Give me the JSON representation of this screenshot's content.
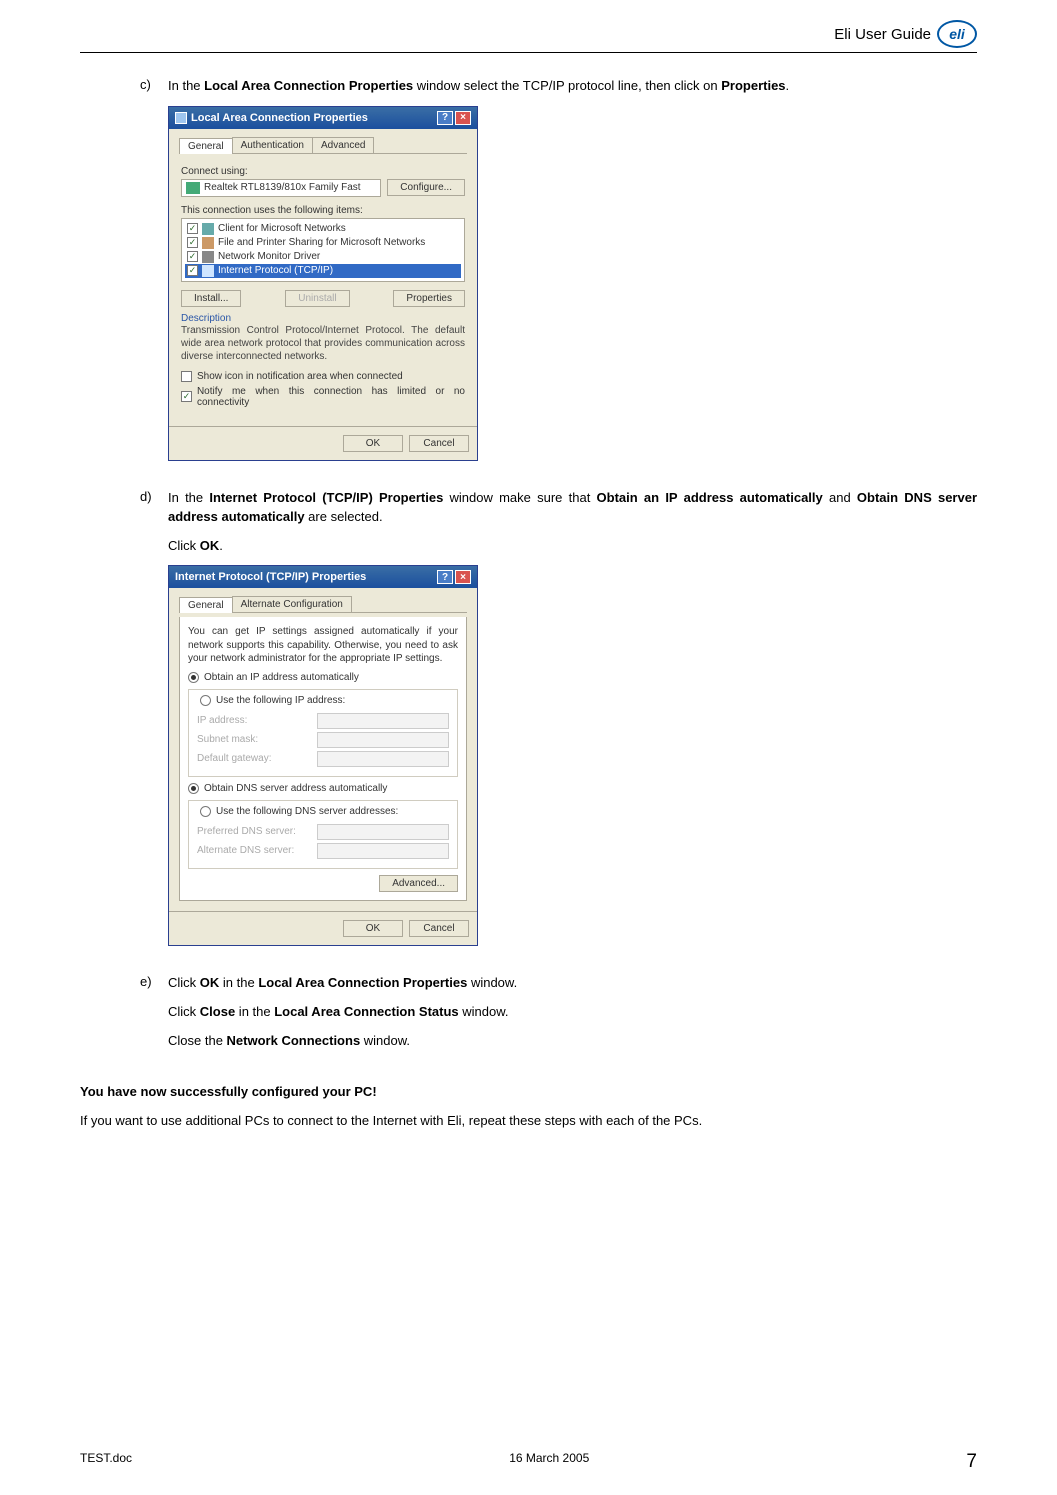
{
  "header": {
    "title": "Eli User Guide",
    "logo_text": "eli"
  },
  "steps": {
    "c": {
      "marker": "c)",
      "text_pre": "In the ",
      "bold1": "Local Area Connection Properties",
      "text_mid": " window select the TCP/IP protocol line, then click on ",
      "bold2": "Properties",
      "text_post": "."
    },
    "d": {
      "marker": "d)",
      "text_pre": "In the ",
      "bold1": "Internet Protocol (TCP/IP) Properties",
      "text_mid1": " window make sure that ",
      "bold2": "Obtain an IP address automatically",
      "text_mid2": " and ",
      "bold3": "Obtain DNS server address automatically",
      "text_post": " are selected.",
      "line2_pre": "Click ",
      "line2_bold": "OK",
      "line2_post": "."
    },
    "e": {
      "marker": "e)",
      "l1_pre": "Click ",
      "l1_b1": "OK",
      "l1_mid": " in the ",
      "l1_b2": "Local Area Connection Properties",
      "l1_post": " window.",
      "l2_pre": "Click ",
      "l2_b1": "Close",
      "l2_mid": " in the ",
      "l2_b2": "Local Area Connection Status",
      "l2_post": " window.",
      "l3_pre": "Close the ",
      "l3_b1": "Network Connections",
      "l3_post": " window."
    }
  },
  "dialog1": {
    "title": "Local Area Connection Properties",
    "tabs": [
      "General",
      "Authentication",
      "Advanced"
    ],
    "connect_using_label": "Connect using:",
    "adapter": "Realtek RTL8139/810x Family Fast",
    "configure_btn": "Configure...",
    "items_label": "This connection uses the following items:",
    "items": [
      "Client for Microsoft Networks",
      "File and Printer Sharing for Microsoft Networks",
      "Network Monitor Driver",
      "Internet Protocol (TCP/IP)"
    ],
    "install_btn": "Install...",
    "uninstall_btn": "Uninstall",
    "properties_btn": "Properties",
    "desc_label": "Description",
    "desc": "Transmission Control Protocol/Internet Protocol. The default wide area network protocol that provides communication across diverse interconnected networks.",
    "show_icon": "Show icon in notification area when connected",
    "notify": "Notify me when this connection has limited or no connectivity",
    "ok": "OK",
    "cancel": "Cancel"
  },
  "dialog2": {
    "title": "Internet Protocol (TCP/IP) Properties",
    "tabs": [
      "General",
      "Alternate Configuration"
    ],
    "note": "You can get IP settings assigned automatically if your network supports this capability. Otherwise, you need to ask your network administrator for the appropriate IP settings.",
    "radio_auto_ip": "Obtain an IP address automatically",
    "radio_manual_ip": "Use the following IP address:",
    "ip_label": "IP address:",
    "subnet_label": "Subnet mask:",
    "gateway_label": "Default gateway:",
    "radio_auto_dns": "Obtain DNS server address automatically",
    "radio_manual_dns": "Use the following DNS server addresses:",
    "pref_dns": "Preferred DNS server:",
    "alt_dns": "Alternate DNS server:",
    "advanced": "Advanced...",
    "ok": "OK",
    "cancel": "Cancel"
  },
  "success_msg": "You have now successfully configured your PC!",
  "followup_msg": "If you want to use additional PCs to connect to the Internet with  Eli, repeat these steps with each of the PCs.",
  "footer": {
    "left": "TEST.doc",
    "center": "16 March 2005",
    "right": "7"
  }
}
